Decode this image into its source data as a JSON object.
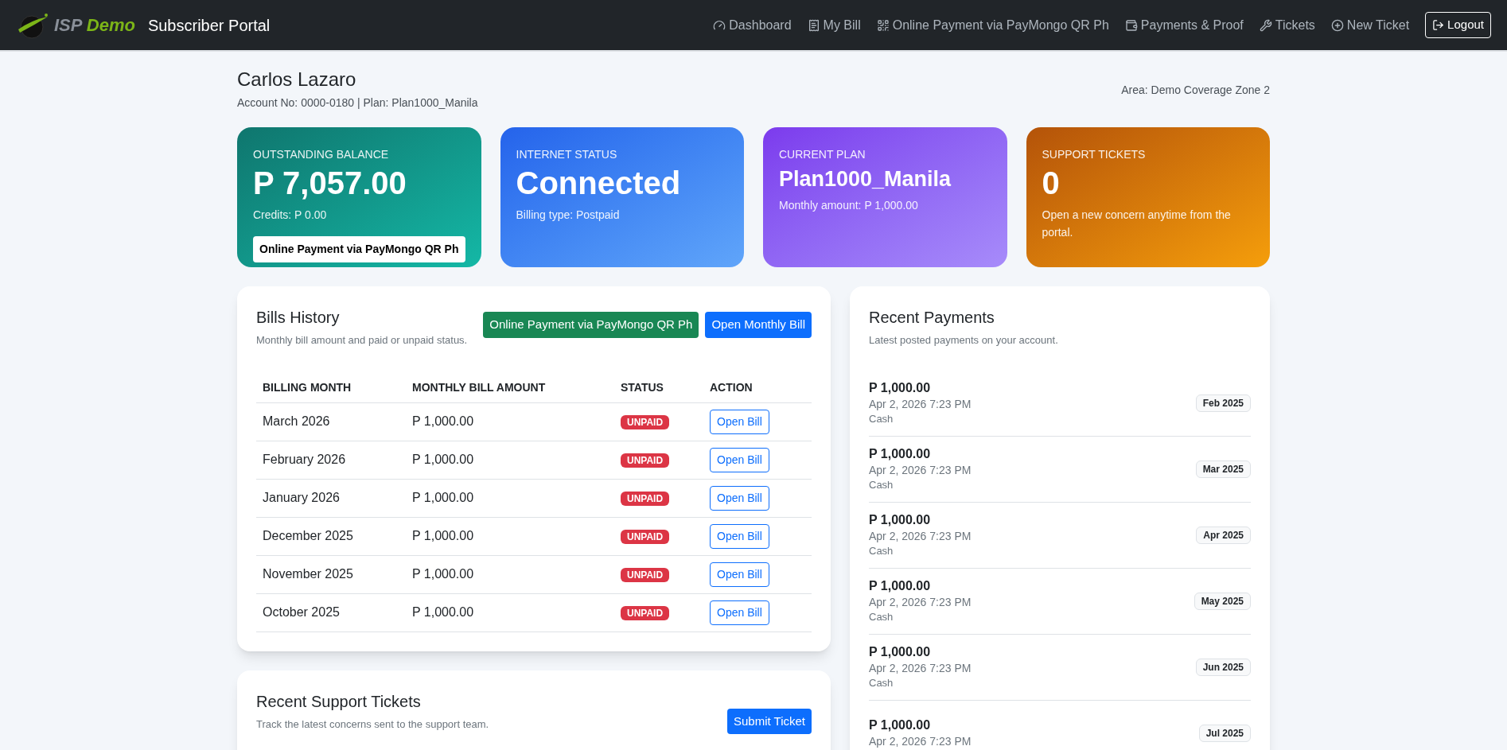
{
  "navbar": {
    "brand": {
      "part_1": "ISP",
      "part_2": "Demo"
    },
    "title": "Subscriber Portal",
    "links": [
      {
        "kind": "dashboard",
        "label": "Dashboard"
      },
      {
        "kind": "bill",
        "label": "My Bill"
      },
      {
        "kind": "qr",
        "label": "Online Payment via PayMongo QR Ph"
      },
      {
        "kind": "wallet",
        "label": "Payments & Proof"
      },
      {
        "kind": "tools",
        "label": "Tickets"
      },
      {
        "kind": "plus",
        "label": "New Ticket"
      }
    ],
    "logout": "Logout"
  },
  "header": {
    "name": "Carlos Lazaro",
    "account": "Account No: 0000-0180 | Plan: Plan1000_Manila",
    "area": "Area: Demo Coverage Zone 2"
  },
  "cards": [
    {
      "kind": "teal",
      "label": "OUTSTANDING BALANCE",
      "value": "P 7,057.00",
      "note": "Credits: P 0.00",
      "button": "Online Payment via PayMongo QR Ph"
    },
    {
      "kind": "blue",
      "label": "INTERNET STATUS",
      "value": "Connected",
      "note": "Billing type: Postpaid"
    },
    {
      "kind": "purple",
      "label": "CURRENT PLAN",
      "value": "Plan1000_Manila",
      "note": "Monthly amount: P 1,000.00"
    },
    {
      "kind": "orange",
      "label": "SUPPORT TICKETS",
      "value": "0",
      "note": "Open a new concern anytime from the portal."
    }
  ],
  "bills": {
    "title": "Bills History",
    "subtitle": "Monthly bill amount and paid or unpaid status.",
    "pay_button": "Online Payment via PayMongo QR Ph",
    "open_button": "Open Monthly Bill",
    "columns": [
      "BILLING MONTH",
      "MONTHLY BILL AMOUNT",
      "STATUS",
      "ACTION"
    ],
    "rows": [
      {
        "month": "March 2026",
        "amount": "P 1,000.00",
        "status": "UNPAID",
        "paid": false,
        "action": "Open Bill"
      },
      {
        "month": "February 2026",
        "amount": "P 1,000.00",
        "status": "UNPAID",
        "paid": false,
        "action": "Open Bill"
      },
      {
        "month": "January 2026",
        "amount": "P 1,000.00",
        "status": "UNPAID",
        "paid": false,
        "action": "Open Bill"
      },
      {
        "month": "December 2025",
        "amount": "P 1,000.00",
        "status": "UNPAID",
        "paid": false,
        "action": "Open Bill"
      },
      {
        "month": "November 2025",
        "amount": "P 1,000.00",
        "status": "UNPAID",
        "paid": false,
        "action": "Open Bill"
      },
      {
        "month": "October 2025",
        "amount": "P 1,000.00",
        "status": "UNPAID",
        "paid": false,
        "action": "Open Bill"
      }
    ]
  },
  "tickets": {
    "title": "Recent Support Tickets",
    "subtitle": "Track the latest concerns sent to the support team.",
    "button": "Submit Ticket"
  },
  "payments": {
    "title": "Recent Payments",
    "subtitle": "Latest posted payments on your account.",
    "items": [
      {
        "amount": "P 1,000.00",
        "date": "Apr 2, 2026 7:23 PM",
        "method": "Cash",
        "period": "Feb 2025"
      },
      {
        "amount": "P 1,000.00",
        "date": "Apr 2, 2026 7:23 PM",
        "method": "Cash",
        "period": "Mar 2025"
      },
      {
        "amount": "P 1,000.00",
        "date": "Apr 2, 2026 7:23 PM",
        "method": "Cash",
        "period": "Apr 2025"
      },
      {
        "amount": "P 1,000.00",
        "date": "Apr 2, 2026 7:23 PM",
        "method": "Cash",
        "period": "May 2025"
      },
      {
        "amount": "P 1,000.00",
        "date": "Apr 2, 2026 7:23 PM",
        "method": "Cash",
        "period": "Jun 2025"
      },
      {
        "amount": "P 1,000.00",
        "date": "Apr 2, 2026 7:23 PM",
        "period": "Jul 2025"
      }
    ]
  }
}
